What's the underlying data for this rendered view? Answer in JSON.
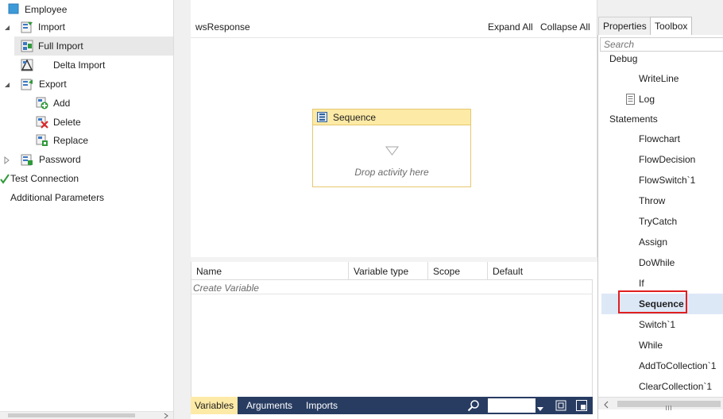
{
  "tree": {
    "root": "Employee",
    "import": "Import",
    "full_import": "Full Import",
    "delta_import": "Delta Import",
    "export": "Export",
    "add": "Add",
    "delete": "Delete",
    "replace": "Replace",
    "password": "Password",
    "test_connection": "Test Connection",
    "additional_parameters": "Additional Parameters"
  },
  "designer": {
    "breadcrumb": "wsResponse",
    "expand_all": "Expand All",
    "collapse_all": "Collapse All",
    "sequence_title": "Sequence",
    "drop_hint": "Drop activity here"
  },
  "variables": {
    "columns": [
      "Name",
      "Variable type",
      "Scope",
      "Default"
    ],
    "create_placeholder": "Create Variable"
  },
  "bottom_tabs": [
    "Variables",
    "Arguments",
    "Imports"
  ],
  "right_panel": {
    "tabs": [
      "Properties",
      "Toolbox"
    ],
    "search_placeholder": "Search",
    "categories": [
      {
        "name": "Debug",
        "items": [
          "WriteLine",
          "Log"
        ]
      },
      {
        "name": "Statements",
        "items": [
          "Flowchart",
          "FlowDecision",
          "FlowSwitch`1",
          "Throw",
          "TryCatch",
          "Assign",
          "DoWhile",
          "If",
          "Sequence",
          "Switch`1",
          "While",
          "AddToCollection`1",
          "ClearCollection`1"
        ]
      }
    ],
    "selected_item": "Sequence"
  },
  "colors": {
    "bottom_bar": "#283c62",
    "sequence_header": "#fdeaa6",
    "highlight": "#e02020"
  }
}
